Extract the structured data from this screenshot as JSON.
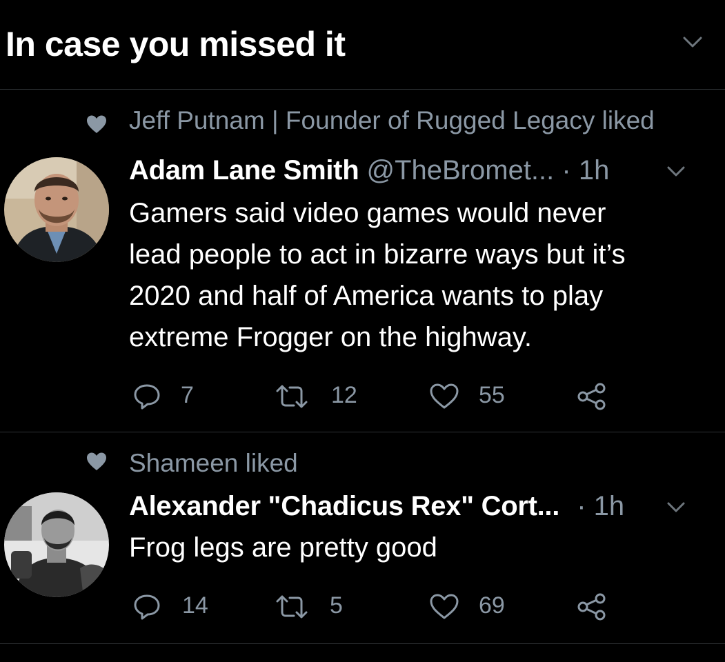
{
  "header": {
    "title": "In case you missed it",
    "chevron_icon": "chevron-down-icon"
  },
  "tweets": [
    {
      "social_context": "Jeff Putnam | Founder of Rugged Legacy liked",
      "display_name": "Adam Lane Smith",
      "handle": "@TheBromet...",
      "separator": "·",
      "time": "1h",
      "text_lines": [
        "Gamers said video games would never",
        "lead people to act in bizarre ways but it’s",
        "2020 and half of America wants to play",
        "extreme Frogger on the highway."
      ],
      "replies": "7",
      "retweets": "12",
      "likes": "55"
    },
    {
      "social_context": "Shameen liked",
      "display_name": "Alexander \"Chadicus Rex\" Cort...",
      "handle": "",
      "separator": "·",
      "time": "1h",
      "text_lines": [
        "Frog legs are pretty good"
      ],
      "replies": "14",
      "retweets": "5",
      "likes": "69"
    }
  ],
  "colors": {
    "background": "#000000",
    "primary_text": "#ffffff",
    "secondary_text": "#8b98a5",
    "divider": "#2f3336"
  },
  "icons": {
    "reply": "reply-icon",
    "retweet": "retweet-icon",
    "like": "heart-icon",
    "share": "share-icon",
    "social_context": "heart-filled-icon"
  }
}
